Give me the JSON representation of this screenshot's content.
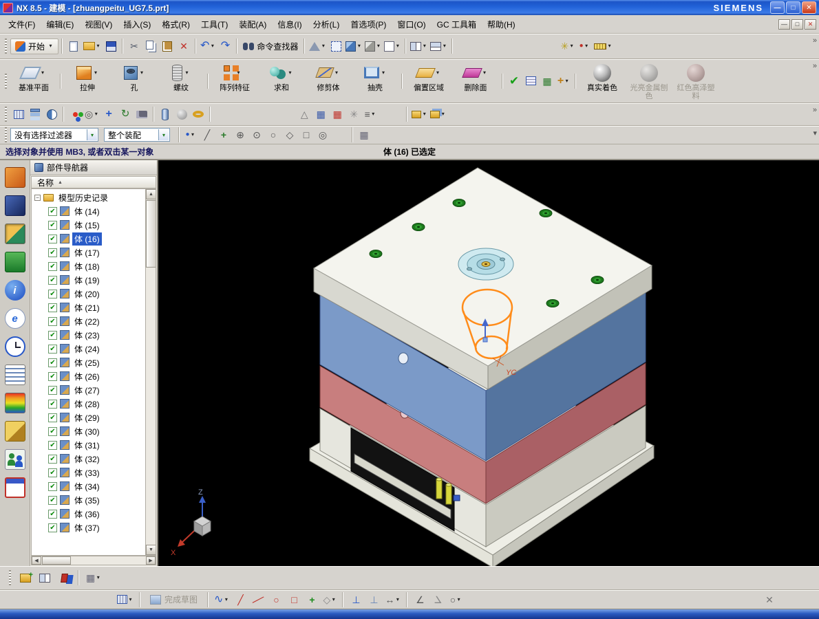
{
  "icons": {
    "caret": "▾",
    "overflow": "»",
    "minimize": "—",
    "maximize": "□",
    "close": "✕",
    "check": "✔",
    "sort_asc": "▲",
    "collapse": "−",
    "cut": "✂",
    "undo": "↶",
    "redo": "↷",
    "up": "▲",
    "down": "▼",
    "left": "◀",
    "right": "▶",
    "triangle": "△",
    "grid": "▦",
    "circle": "○",
    "circled_dot": "⊙",
    "circled_plus": "⊕",
    "diamond": "◇",
    "slash": "╱",
    "wave": "∿",
    "perp": "⊥",
    "angle": "∠",
    "resize": "↔",
    "plus": "+",
    "infinity": "∞",
    "bars": "≡",
    "star": "✳",
    "target": "◎",
    "box": "□",
    "bullet": "●",
    "info": "i",
    "explorer": "e",
    "rotate": "↻"
  },
  "window": {
    "title": "NX 8.5 - 建模 - [zhuangpeitu_UG7.5.prt]",
    "brand": "SIEMENS"
  },
  "menubar": {
    "items": [
      "文件(F)",
      "编辑(E)",
      "视图(V)",
      "插入(S)",
      "格式(R)",
      "工具(T)",
      "装配(A)",
      "信息(I)",
      "分析(L)",
      "首选项(P)",
      "窗口(O)",
      "GC 工具箱",
      "帮助(H)"
    ]
  },
  "standard_toolbar": {
    "start": "开始",
    "command_finder": "命令查找器"
  },
  "feature_toolbar": {
    "buttons": [
      "基准平面",
      "拉伸",
      "孔",
      "螺纹",
      "阵列特征",
      "求和",
      "修剪体",
      "抽壳",
      "偏置区域",
      "删除面"
    ],
    "render_buttons": [
      "真实着色",
      "光亮金属刨色",
      "红色高泽塑料"
    ]
  },
  "selection_bar": {
    "filter": "没有选择过滤器",
    "scope": "整个装配"
  },
  "prompt_bar": {
    "message": "选择对象并使用 MB3, 或者双击某一对象",
    "status": "体 (16) 已选定"
  },
  "navigator": {
    "title": "部件导航器",
    "column": "名称",
    "root": "模型历史记录",
    "selected_item": "体 (16)",
    "items": [
      "体 (14)",
      "体 (15)",
      "体 (16)",
      "体 (17)",
      "体 (18)",
      "体 (19)",
      "体 (20)",
      "体 (21)",
      "体 (22)",
      "体 (23)",
      "体 (24)",
      "体 (25)",
      "体 (26)",
      "体 (27)",
      "体 (28)",
      "体 (29)",
      "体 (30)",
      "体 (31)",
      "体 (32)",
      "体 (33)",
      "体 (34)",
      "体 (35)",
      "体 (36)",
      "体 (37)"
    ]
  },
  "viewport": {
    "triad": {
      "z": "Z",
      "x": "X"
    },
    "wcs_label": "YC"
  },
  "sketch_toolbar": {
    "finish": "完成草图"
  },
  "colors": {
    "selection_blue": "#2a5cc8",
    "top_plate": "#f4f4ee",
    "a_plate_blue": "#7b9ac8",
    "b_plate_red": "#c87e7e",
    "highlight_orange": "#ff8c1a",
    "viewport_bg": "#000000"
  }
}
